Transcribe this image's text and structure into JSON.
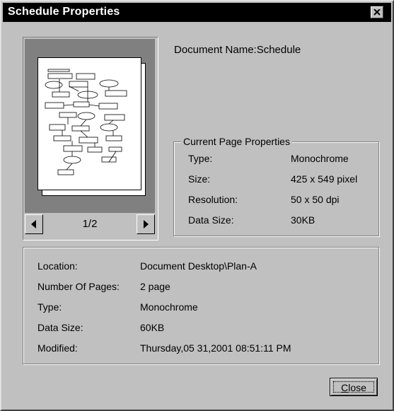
{
  "window": {
    "title": "Schedule Properties"
  },
  "document_name": "Document Name:Schedule",
  "pager": {
    "indicator": "1/2"
  },
  "current_page": {
    "legend": "Current Page Properties",
    "rows": [
      {
        "label": "Type:",
        "value": "Monochrome"
      },
      {
        "label": "Size:",
        "value": "425 x 549 pixel"
      },
      {
        "label": "Resolution:",
        "value": "50 x 50 dpi"
      },
      {
        "label": "Data Size:",
        "value": "30KB"
      }
    ]
  },
  "document": {
    "rows": [
      {
        "label": "Location:",
        "value": "Document Desktop\\Plan-A"
      },
      {
        "label": "Number Of Pages:",
        "value": "2 page"
      },
      {
        "label": "Type:",
        "value": "Monochrome"
      },
      {
        "label": "Data Size:",
        "value": "60KB"
      },
      {
        "label": "Modified:",
        "value": "Thursday,05 31,2001 08:51:11 PM"
      }
    ]
  },
  "buttons": {
    "close_label": "Close"
  },
  "colors": {
    "dialog_face": "#c0c0c0",
    "titlebar": "#000000",
    "preview_bg": "#808080"
  },
  "icons": [
    "close-icon",
    "left-arrow-icon",
    "right-arrow-icon"
  ]
}
